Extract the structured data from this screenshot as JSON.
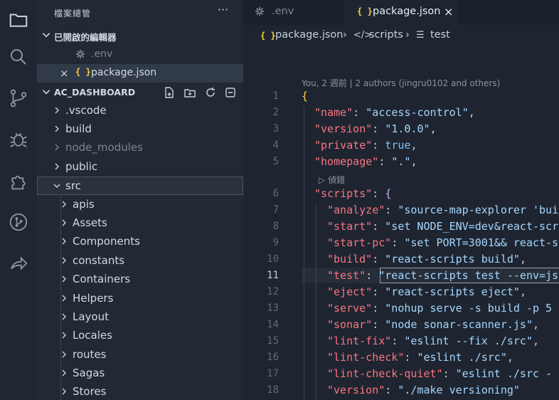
{
  "sidebar": {
    "title": "檔案總管",
    "more": "···",
    "open_editors": {
      "label": "已開啟的編輯器",
      "items": [
        {
          "label": ".env",
          "icon": "gear-icon",
          "close": ""
        },
        {
          "label": "package.json",
          "icon": "braces-icon",
          "close": "×"
        }
      ]
    },
    "project": {
      "label": "AC_DASHBOARD",
      "items": [
        {
          "label": ".vscode"
        },
        {
          "label": "build"
        },
        {
          "label": "node_modules"
        },
        {
          "label": "public"
        },
        {
          "label": "src"
        },
        {
          "label": "apis"
        },
        {
          "label": "Assets"
        },
        {
          "label": "Components"
        },
        {
          "label": "constants"
        },
        {
          "label": "Containers"
        },
        {
          "label": "Helpers"
        },
        {
          "label": "Layout"
        },
        {
          "label": "Locales"
        },
        {
          "label": "routes"
        },
        {
          "label": "Sagas"
        },
        {
          "label": "Stores"
        }
      ]
    }
  },
  "tabs": [
    {
      "label": ".env",
      "icon": "gear-icon"
    },
    {
      "label": "package.json",
      "icon": "braces-icon",
      "close": "×"
    }
  ],
  "breadcrumb": {
    "file": "package.json",
    "sep": "›",
    "section": "scripts",
    "key": "test"
  },
  "editor": {
    "blame": "You, 2 週前 | 2 authors (jingru0102 and others)",
    "codelens": "▷ 偵錯",
    "current_line": "11",
    "line_numbers": [
      "1",
      "2",
      "3",
      "4",
      "5",
      "6",
      "7",
      "8",
      "9",
      "10",
      "11",
      "12",
      "13",
      "14",
      "15",
      "16",
      "17",
      "18"
    ],
    "lines": [
      {
        "key": "",
        "value": "",
        "text": "{"
      },
      {
        "key": "\"name\"",
        "value": "\"access-control\"",
        "tail": ","
      },
      {
        "key": "\"version\"",
        "value": "\"1.0.0\"",
        "tail": ","
      },
      {
        "key": "\"private\"",
        "value": "true",
        "tail": ","
      },
      {
        "key": "\"homepage\"",
        "value": "\".\"",
        "tail": ","
      },
      {
        "key": "\"scripts\"",
        "value": "{",
        "tail": ""
      },
      {
        "key": "\"analyze\"",
        "value": "\"source-map-explorer 'bui",
        "tail": ""
      },
      {
        "key": "\"start\"",
        "value": "\"set NODE_ENV=dev&react-scr",
        "tail": ""
      },
      {
        "key": "\"start-pc\"",
        "value": "\"set PORT=3001&& react-s",
        "tail": ""
      },
      {
        "key": "\"build\"",
        "value": "\"react-scripts build\"",
        "tail": ","
      },
      {
        "key": "\"test\"",
        "value": "\"react-scripts test --env=js",
        "tail": ""
      },
      {
        "key": "\"eject\"",
        "value": "\"react-scripts eject\"",
        "tail": ","
      },
      {
        "key": "\"serve\"",
        "value": "\"nohup serve -s build -p 5",
        "tail": ""
      },
      {
        "key": "\"sonar\"",
        "value": "\"node sonar-scanner.js\"",
        "tail": ","
      },
      {
        "key": "\"lint-fix\"",
        "value": "\"eslint --fix ./src\"",
        "tail": ","
      },
      {
        "key": "\"lint-check\"",
        "value": "\"eslint ./src\"",
        "tail": ","
      },
      {
        "key": "\"lint-check-quiet\"",
        "value": "\"eslint ./src -",
        "tail": ""
      },
      {
        "key": "\"version\"",
        "value": "\"./make versioning\"",
        "tail": ""
      }
    ]
  },
  "colors": {
    "accent": "#79c0ff",
    "key": "#f97583",
    "string": "#a5d6ff",
    "brace": "#ffd33d"
  }
}
